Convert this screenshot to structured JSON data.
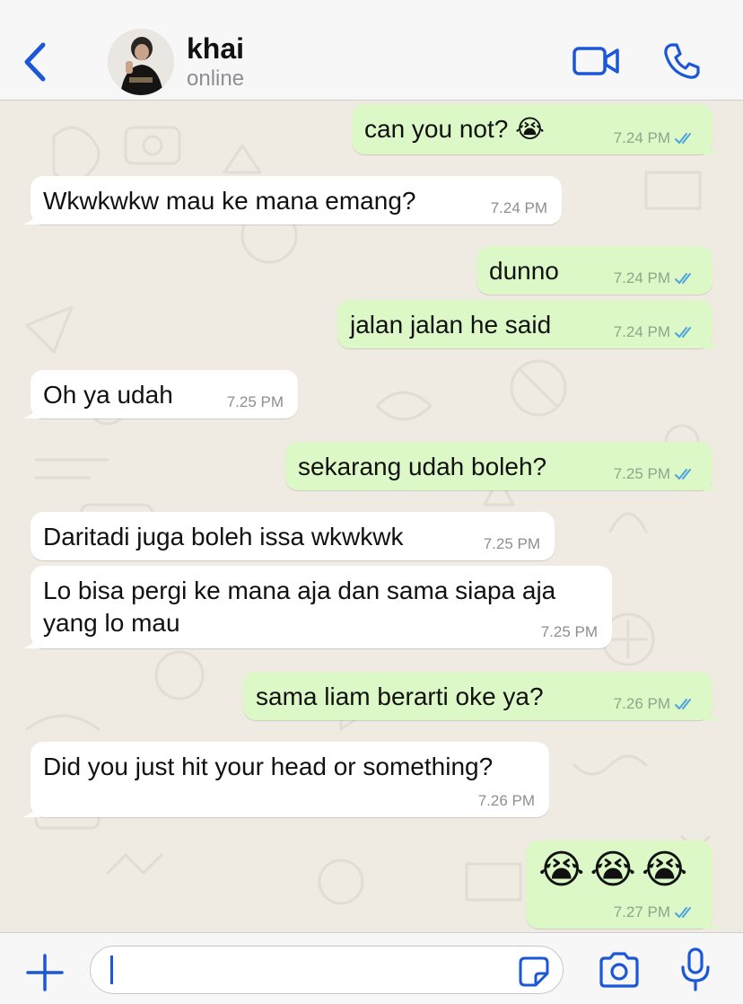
{
  "header": {
    "contact_name": "khai",
    "status": "online"
  },
  "messages": [
    {
      "direction": "out",
      "text": "can you not? 😭",
      "time": "7.24 PM",
      "read": true
    },
    {
      "direction": "in",
      "text": "Wkwkwkw mau ke mana emang?",
      "time": "7.24 PM"
    },
    {
      "direction": "out",
      "text": "dunno",
      "time": "7.24 PM",
      "read": true
    },
    {
      "direction": "out",
      "text": "jalan jalan he said",
      "time": "7.24 PM",
      "read": true
    },
    {
      "direction": "in",
      "text": "Oh ya udah",
      "time": "7.25 PM"
    },
    {
      "direction": "out",
      "text": "sekarang udah boleh?",
      "time": "7.25 PM",
      "read": true
    },
    {
      "direction": "in",
      "text": "Daritadi juga boleh issa wkwkwk",
      "time": "7.25 PM"
    },
    {
      "direction": "in",
      "text_line1": "Lo bisa pergi ke mana aja dan sama siapa aja",
      "text_line2": "yang lo mau",
      "time": "7.25 PM"
    },
    {
      "direction": "out",
      "text": "sama liam berarti oke ya?",
      "time": "7.26 PM",
      "read": true
    },
    {
      "direction": "in",
      "text": "Did you just hit your head or something?",
      "time": "7.26 PM"
    },
    {
      "direction": "out",
      "text": "😭😭😭",
      "time": "7.27 PM",
      "read": true
    }
  ],
  "composer": {
    "value": ""
  },
  "colors": {
    "accent": "#1b57d6",
    "outgoing_bubble": "#dcf8c6",
    "incoming_bubble": "#ffffff",
    "wallpaper": "#efeae2",
    "read_ticks": "#4fa3e0"
  },
  "icons": {
    "back": "chevron-left-icon",
    "video": "video-camera-icon",
    "call": "phone-icon",
    "attach": "plus-icon",
    "sticker": "sticker-icon",
    "camera": "camera-icon",
    "mic": "microphone-icon",
    "read_receipt": "double-check-icon"
  }
}
